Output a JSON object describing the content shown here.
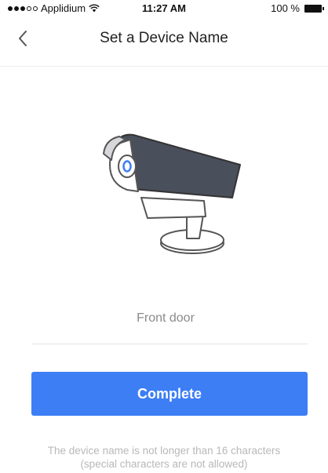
{
  "status_bar": {
    "carrier": "Applidium",
    "time": "11:27 AM",
    "battery": "100 %"
  },
  "nav": {
    "title": "Set a Device Name",
    "back_icon": "chevron-left-icon"
  },
  "illustration": {
    "icon": "security-camera-icon",
    "colors": {
      "housing": "#4a4f5c",
      "lens": "#3d7ef5"
    }
  },
  "device_name": {
    "value": "Front door",
    "placeholder": ""
  },
  "actions": {
    "complete_label": "Complete"
  },
  "hint": {
    "line1": "The device name is not longer than 16 characters",
    "line2": "(special characters are not allowed)"
  },
  "colors": {
    "accent": "#3d7ef5",
    "hint_text": "#b8b8b8"
  }
}
